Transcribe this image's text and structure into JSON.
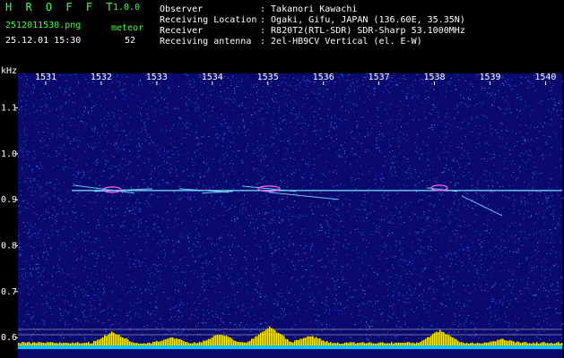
{
  "header": {
    "app_name": "H R O F F T",
    "version": "1.0.0",
    "filename": "2512011530.png",
    "datetime": "25.12.01 15:30",
    "meteor_label": "meteor",
    "meteor_count": "52",
    "fields": [
      {
        "label": "Observer",
        "value": ": Takanori Kawachi"
      },
      {
        "label": "Receiving Location",
        "value": ": Ogaki, Gifu, JAPAN (136.60E, 35.35N)"
      },
      {
        "label": "Receiver",
        "value": ": R820T2(RTL-SDR) SDR-Sharp 53.1000MHz"
      },
      {
        "label": "Receiving antenna",
        "value": ": 2el-HB9CV Vertical (el. E-W)"
      }
    ]
  },
  "spectrogram": {
    "y_unit": "kHz",
    "y_ticks": [
      "1.1",
      "1.0",
      "0.9",
      "0.8",
      "0.7",
      "0.6"
    ],
    "y_tick_values": [
      1.1,
      1.0,
      0.9,
      0.8,
      0.7,
      0.6
    ],
    "x_ticks": [
      "1531",
      "1532",
      "1533",
      "1534",
      "1535",
      "1536",
      "1537",
      "1538",
      "1539",
      "1540"
    ],
    "x_range_min": [
      1530.5,
      1540.3
    ],
    "y_range_khz": [
      0.575,
      1.175
    ],
    "carrier_khz": 0.92,
    "colors": {
      "background": "#0a0a6e",
      "noise": "#2a5bd6",
      "carrier": "#7fe0ff",
      "echo": "#ff60ff",
      "power_bars": "#ffee00",
      "baseline": "#00c8ff",
      "tick_text": "#ffffff"
    }
  }
}
